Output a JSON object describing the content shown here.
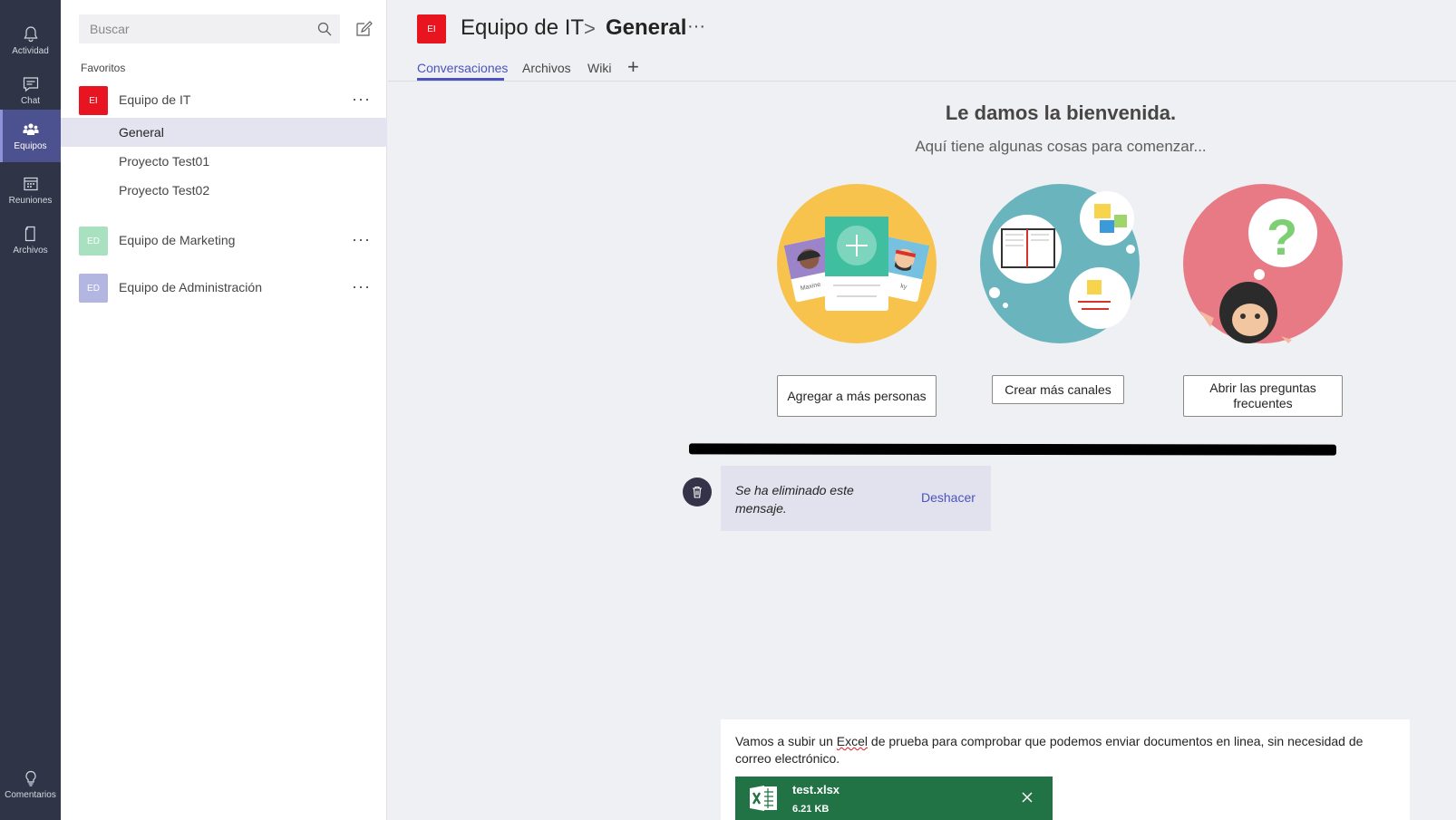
{
  "appbar": {
    "items": [
      {
        "label": "Actividad",
        "icon": "bell-icon"
      },
      {
        "label": "Chat",
        "icon": "chat-icon"
      },
      {
        "label": "Equipos",
        "icon": "teams-icon",
        "active": true
      },
      {
        "label": "Reuniones",
        "icon": "calendar-icon"
      },
      {
        "label": "Archivos",
        "icon": "file-icon"
      }
    ],
    "feedback_label": "Comentarios"
  },
  "sidebar": {
    "search_placeholder": "Buscar",
    "favorites_title": "Favoritos",
    "teams": [
      {
        "initials": "EI",
        "name": "Equipo de IT",
        "color": "#e8141f",
        "channels": [
          "General",
          "Proyecto Test01",
          "Proyecto Test02"
        ]
      },
      {
        "initials": "ED",
        "name": "Equipo de Marketing",
        "color": "#a8e0c0"
      },
      {
        "initials": "ED",
        "name": "Equipo de Administración",
        "color": "#b4b6e2"
      }
    ]
  },
  "header": {
    "team_initials": "EI",
    "team_name": "Equipo de IT",
    "separator": ">",
    "channel_name": "General",
    "more": "···",
    "tabs": [
      "Conversaciones",
      "Archivos",
      "Wiki"
    ],
    "add_tab": "+"
  },
  "welcome": {
    "title": "Le damos la bienvenida.",
    "subtitle": "Aquí tiene algunas cosas para comenzar...",
    "cards": [
      {
        "illustration": "add-people-illustration",
        "button": "Agregar a más personas",
        "label_left": "Maxine",
        "label_right": "ky"
      },
      {
        "illustration": "channels-illustration",
        "button": "Crear más canales"
      },
      {
        "illustration": "faq-illustration",
        "button": "Abrir las preguntas frecuentes"
      }
    ]
  },
  "deleted_message": {
    "text": "Se ha eliminado este mensaje.",
    "undo": "Deshacer"
  },
  "compose": {
    "text_before": "Vamos a subir un ",
    "text_flagged": "Excel",
    "text_after": " de prueba para comprobar que podemos enviar documentos en linea, sin necesidad de correo electrónico.",
    "attachment": {
      "name": "test.xlsx",
      "size": "6.21 KB",
      "icon": "excel-icon"
    }
  },
  "colors": {
    "accent": "#4b53bc",
    "appbar": "#2f3447",
    "excel": "#217346",
    "team_it": "#e8141f"
  }
}
